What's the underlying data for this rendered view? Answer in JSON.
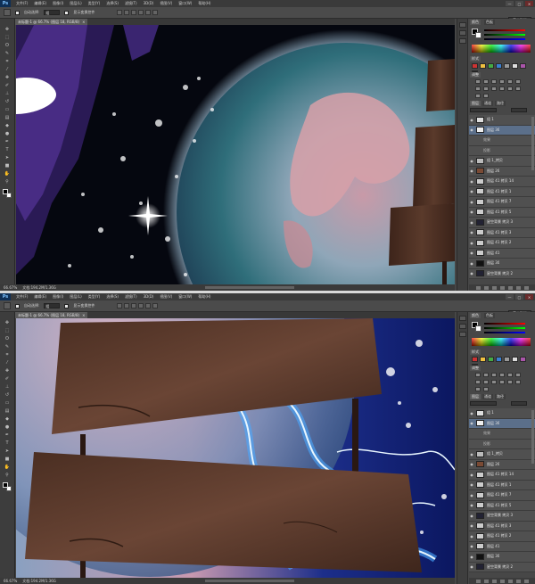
{
  "app": {
    "logo": "Ps"
  },
  "menu": [
    "文件(F)",
    "编辑(E)",
    "图像(I)",
    "图层(L)",
    "类型(Y)",
    "选择(S)",
    "滤镜(T)",
    "3D(D)",
    "视图(V)",
    "窗口(W)",
    "帮助(H)"
  ],
  "window_controls": [
    "—",
    "□",
    "✕"
  ],
  "options": {
    "auto_select_label": "自动选择:",
    "auto_select_value": "组",
    "transform_label": "显示变换控件",
    "workspace": "基本功能"
  },
  "shots": [
    {
      "doc_tab": "未标题-1 @ 66.7% (图层 18, RGB/8)",
      "zoom": "66.67%",
      "doc_info": "文档:194.2M/1.36G",
      "panel_tabs": [
        "颜色",
        "色板"
      ],
      "styles_tab": "样式",
      "adjust_tab": "调整",
      "layers_tabs": [
        "图层",
        "通道",
        "路径"
      ],
      "layers": [
        "组 1",
        "图层 36",
        "效果",
        "投影",
        "组 1_拷贝",
        "图层 26",
        "图层 41 拷贝 14",
        "图层 41 拷贝 1",
        "图层 41 拷贝 7",
        "图层 41 拷贝 5",
        "星空背景 拷贝 3",
        "图层 41 拷贝 3",
        "图层 41 拷贝 2",
        "图层 41",
        "图层 30",
        "星空背景 拷贝 2",
        "图层 41 拷贝",
        "星空背景"
      ]
    },
    {
      "doc_tab": "未标题-1 @ 66.7% (图层 18, RGB/8)",
      "zoom": "66.67%",
      "doc_info": "文档:194.2M/1.36G",
      "panel_tabs": [
        "颜色",
        "色板"
      ],
      "styles_tab": "样式",
      "adjust_tab": "调整",
      "layers_tabs": [
        "图层",
        "通道",
        "路径"
      ],
      "layers": [
        "组 1",
        "图层 36",
        "效果",
        "投影",
        "组 1_拷贝",
        "图层 26",
        "图层 41 拷贝 14",
        "图层 41 拷贝 1",
        "图层 41 拷贝 7",
        "图层 41 拷贝 5",
        "星空背景 拷贝 3",
        "图层 41 拷贝 3",
        "图层 41 拷贝 2",
        "图层 41",
        "图层 30",
        "星空背景 拷贝 2",
        "图层 41 拷贝",
        "星空背景"
      ]
    }
  ],
  "colors": {
    "accent": "#5b6f8a",
    "space": "#05070f",
    "wood": "#4a2e22",
    "earth_ocean": "#2f6e7a",
    "lightning": "#4aa8ff"
  }
}
